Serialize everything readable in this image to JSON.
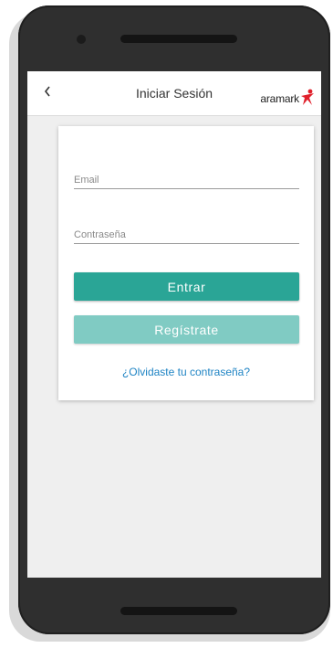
{
  "header": {
    "title": "Iniciar Sesión",
    "logo_text": "aramark",
    "colors": {
      "logo_star": "#e0202b"
    }
  },
  "form": {
    "email_placeholder": "Email",
    "password_placeholder": "Contraseña",
    "login_label": "Entrar",
    "register_label": "Regístrate",
    "forgot_label": "¿Olvidaste tu contraseña?"
  },
  "colors": {
    "primary": "#2aa596",
    "secondary": "#80cbc3",
    "link": "#1f84c4"
  },
  "icons": {
    "back": "chevron-left-icon",
    "logo": "aramark-logo-icon"
  }
}
